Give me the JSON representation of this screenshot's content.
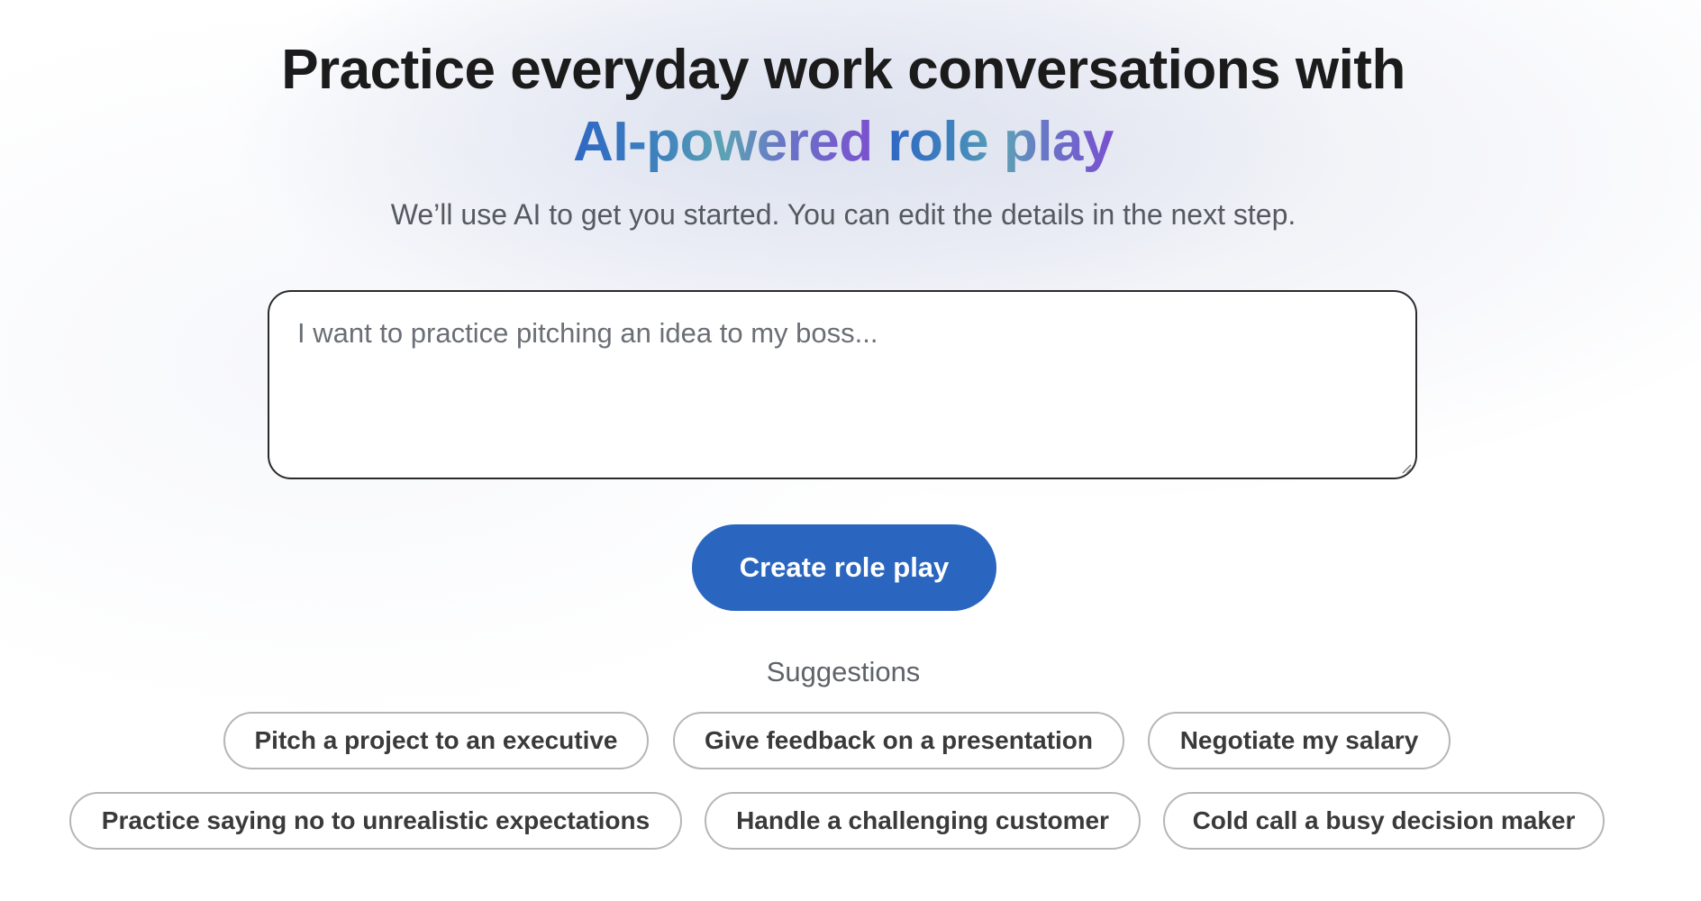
{
  "hero": {
    "title_line_1": "Practice everyday work conversations with",
    "title_gradient_1": "AI-powered",
    "title_gradient_2": "role play",
    "subtitle": "We’ll use AI to get you started. You can edit the details in the next step."
  },
  "prompt": {
    "value": "",
    "placeholder": "I want to practice pitching an idea to my boss..."
  },
  "create_button": {
    "label": "Create role play"
  },
  "suggestions": {
    "label": "Suggestions",
    "items": [
      "Pitch a project to an executive",
      "Give feedback on a presentation",
      "Negotiate my salary",
      "Practice saying no to unrealistic expectations",
      "Handle a challenging customer",
      "Cold call a busy decision maker"
    ]
  },
  "colors": {
    "primary_button": "#2a66bf",
    "gradient_start": "#2f67c4",
    "gradient_end": "#7b4fd1",
    "chip_border": "#b4b6ba"
  }
}
